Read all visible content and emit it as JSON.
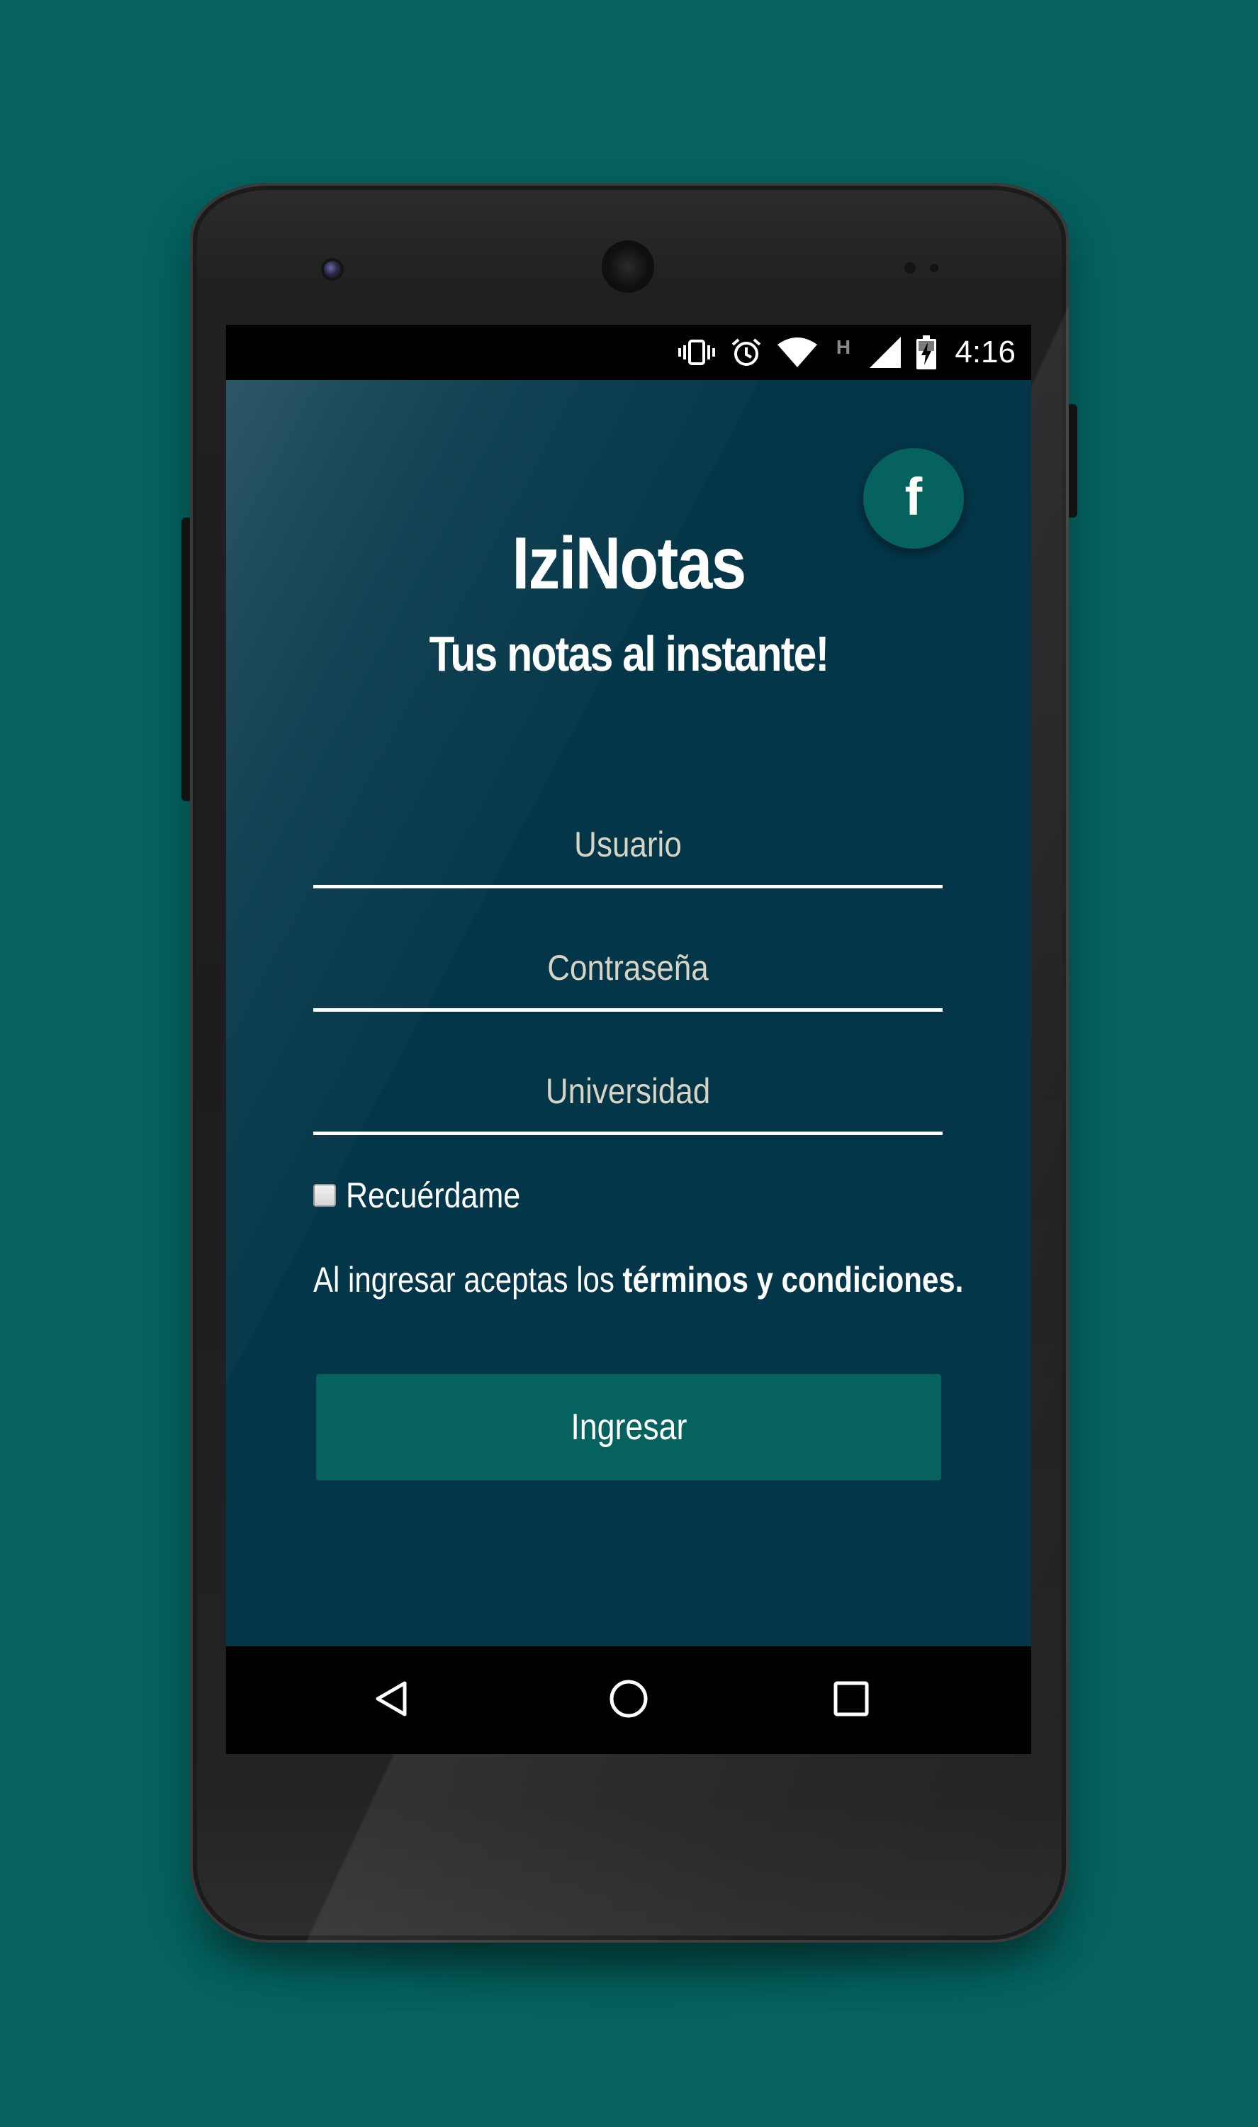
{
  "status_bar": {
    "time": "4:16",
    "network_type": "H",
    "icons": [
      "vibrate-icon",
      "alarm-icon",
      "wifi-icon",
      "network-type-icon",
      "signal-icon",
      "battery-charging-icon"
    ]
  },
  "app": {
    "title": "IziNotas",
    "subtitle": "Tus notas al instante!",
    "facebook_button_label": "f"
  },
  "form": {
    "username_placeholder": "Usuario",
    "password_placeholder": "Contraseña",
    "university_placeholder": "Universidad",
    "remember_label": "Recuérdame",
    "remember_checked": false,
    "terms_prefix": "Al ingresar aceptas los ",
    "terms_link": "términos y condiciones.",
    "submit_label": "Ingresar"
  },
  "nav": {
    "icons": [
      "back-icon",
      "home-icon",
      "recents-icon"
    ]
  },
  "colors": {
    "background": "#05625f",
    "app_background": "#033648",
    "accent": "#05625f",
    "text": "#ffffff",
    "placeholder": "#d8d4c4"
  }
}
